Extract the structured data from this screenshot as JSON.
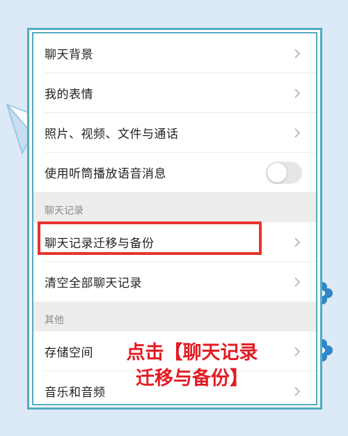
{
  "settings": {
    "rows_top": [
      {
        "label": "聊天背景"
      },
      {
        "label": "我的表情"
      },
      {
        "label": "照片、视频、文件与通话"
      }
    ],
    "toggle_row": {
      "label": "使用听筒播放语音消息",
      "enabled": false
    },
    "section_chat": {
      "header": "聊天记录",
      "rows": [
        {
          "label": "聊天记录迁移与备份"
        },
        {
          "label": "清空全部聊天记录"
        }
      ]
    },
    "section_other": {
      "header": "其他",
      "rows": [
        {
          "label": "存储空间"
        },
        {
          "label": "音乐和音频"
        }
      ]
    }
  },
  "annotation": {
    "line1": "点击【聊天记录",
    "line2": "迁移与备份】"
  },
  "colors": {
    "background": "#dbeaf6",
    "frame": "#53a9c0",
    "highlight": "#e8322c",
    "annotation_text": "#e31b23",
    "section_bg": "#ededed"
  }
}
